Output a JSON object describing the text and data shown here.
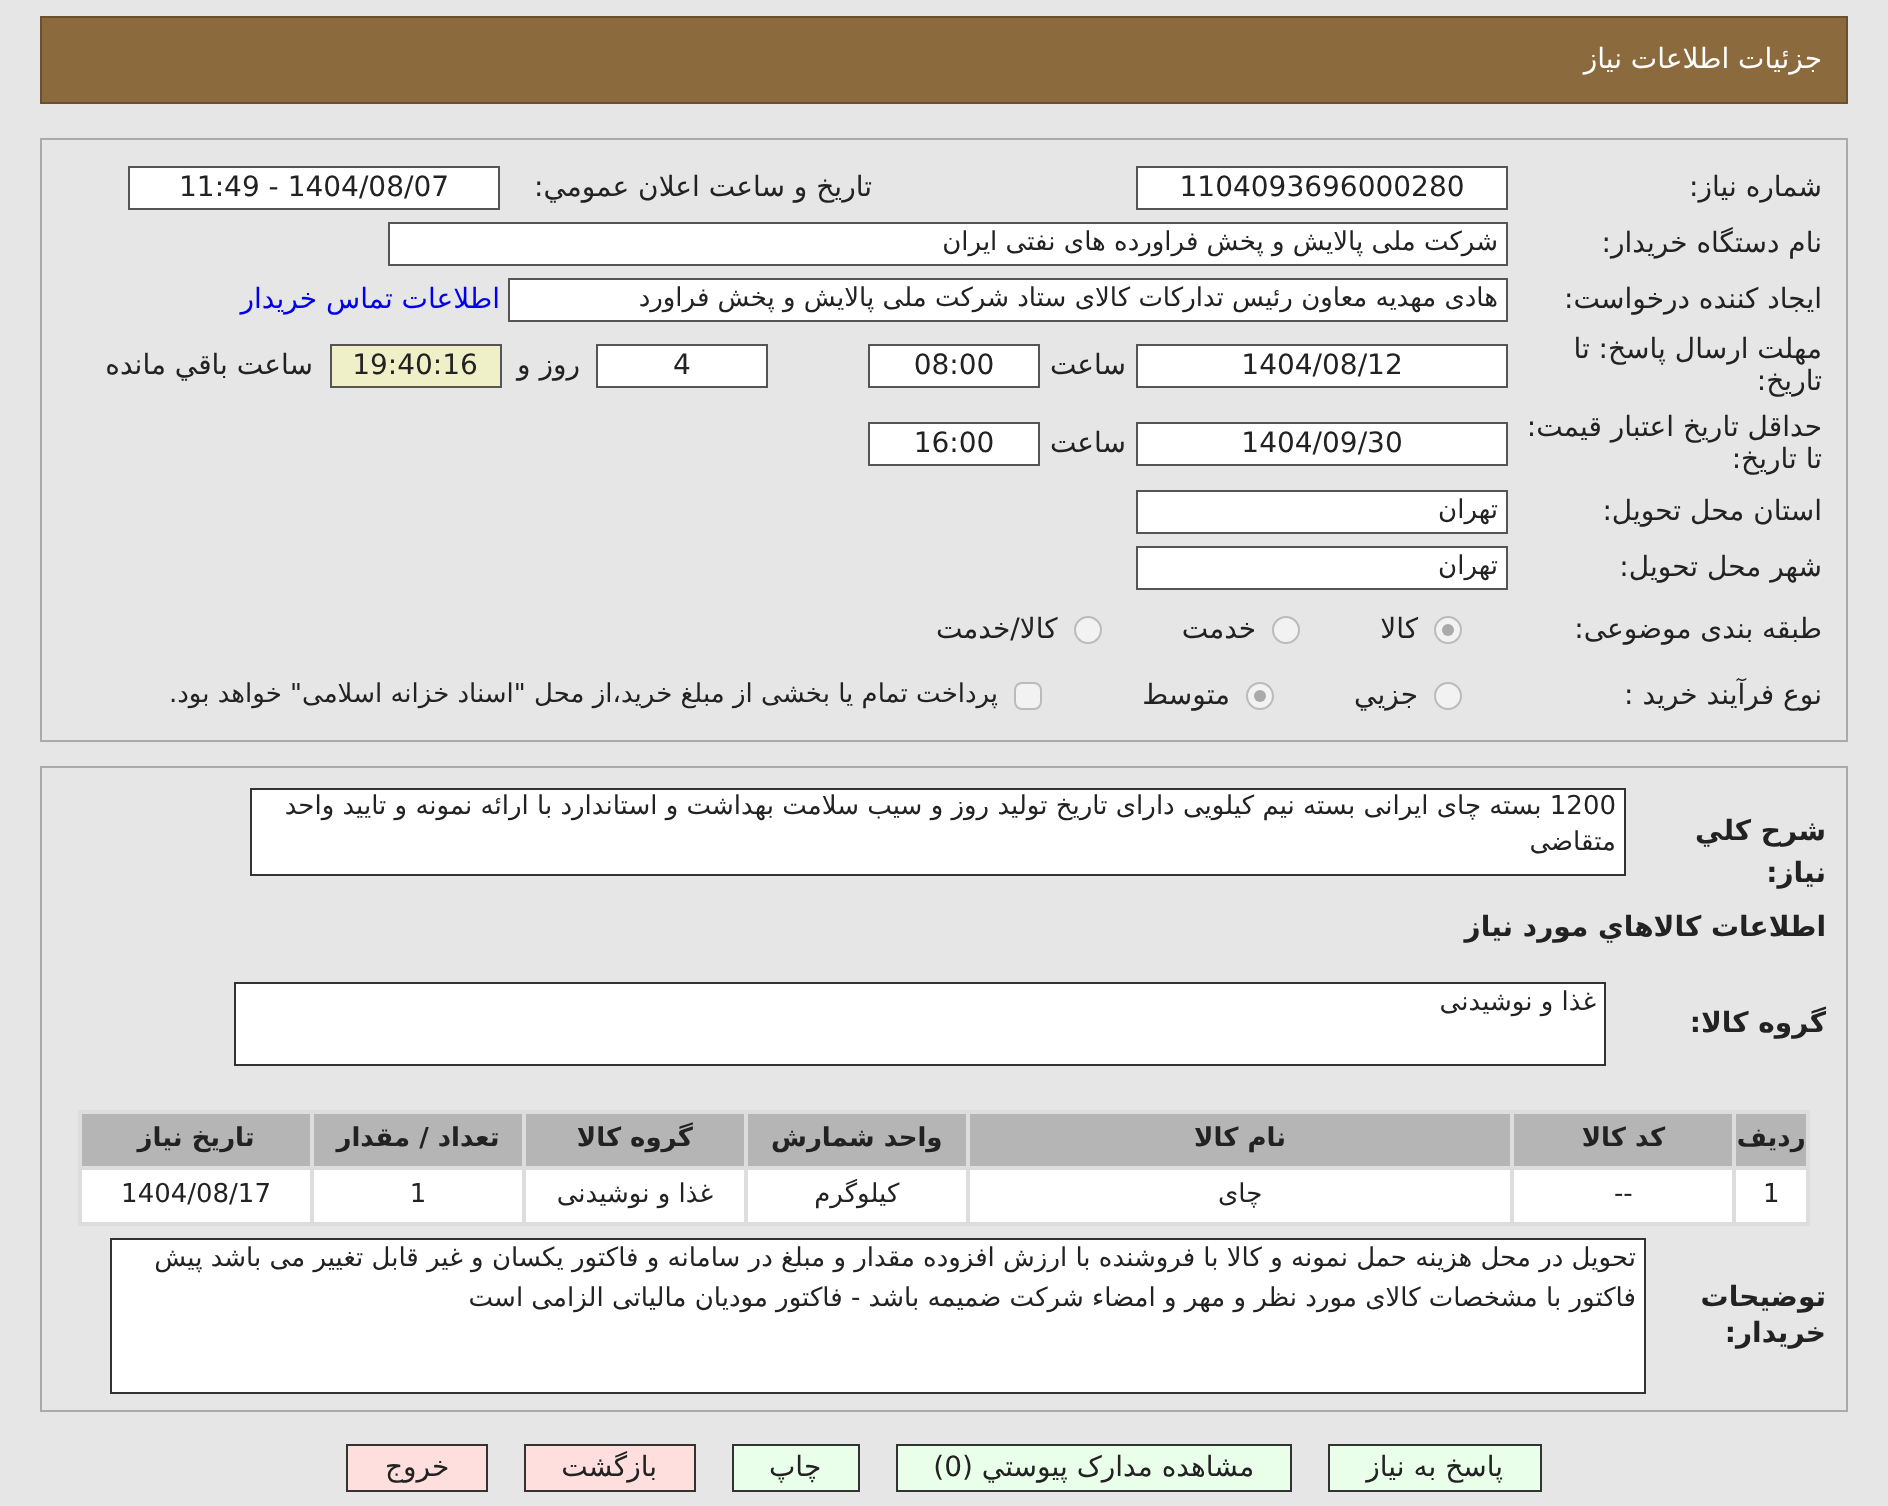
{
  "header": {
    "title": "جزئیات اطلاعات نیاز"
  },
  "need_number": {
    "label": "شماره نیاز:",
    "value": "1104093696000280"
  },
  "announce": {
    "label": "تاريخ و ساعت اعلان عمومي:",
    "value": "1404/08/07 - 11:49"
  },
  "buyer_org": {
    "label": "نام دستگاه خریدار:",
    "value": "شرکت ملی پالایش و پخش فراورده های نفتی ایران"
  },
  "requester": {
    "label": "ایجاد کننده درخواست:",
    "value": "هادی مهدیه معاون رئیس تدارکات کالای ستاد شرکت ملی پالایش و پخش فراورد",
    "link": "اطلاعات تماس خریدار"
  },
  "deadline": {
    "label": "مهلت ارسال پاسخ: تا تاریخ:",
    "date": "1404/08/12",
    "time_label": "ساعت",
    "time": "08:00",
    "days": "4",
    "days_label": "روز و",
    "remaining": "19:40:16",
    "remaining_label": "ساعت باقي مانده"
  },
  "validity": {
    "label": "حداقل تاریخ اعتبار قیمت: تا تاریخ:",
    "date": "1404/09/30",
    "time_label": "ساعت",
    "time": "16:00"
  },
  "province": {
    "label": "استان محل تحویل:",
    "value": "تهران"
  },
  "city": {
    "label": "شهر محل تحویل:",
    "value": "تهران"
  },
  "category": {
    "label": "طبقه بندی موضوعی:",
    "options": [
      {
        "label": "کالا",
        "selected": true
      },
      {
        "label": "خدمت",
        "selected": false
      },
      {
        "label": "کالا/خدمت",
        "selected": false
      }
    ]
  },
  "purchase_type": {
    "label": "نوع فرآیند خرید :",
    "options": [
      {
        "label": "جزيي",
        "selected": false
      },
      {
        "label": "متوسط",
        "selected": true
      }
    ],
    "treasury": {
      "label": "پرداخت تمام یا بخشی از مبلغ خرید،از محل \"اسناد خزانه اسلامی\" خواهد بود.",
      "checked": false
    }
  },
  "description": {
    "label": "شرح كلي نياز:",
    "value": "1200 بسته چای ایرانی بسته نیم کیلویی دارای تاریخ تولید روز و سیب سلامت بهداشت و استاندارد  با ارائه نمونه و تایید واحد متقاضی"
  },
  "goods_title": "اطلاعات كالاهاي مورد نياز",
  "goods_group": {
    "label": "گروه کالا:",
    "value": "غذا و نوشیدنی"
  },
  "table": {
    "columns": [
      "ردیف",
      "کد کالا",
      "نام کالا",
      "واحد شمارش",
      "گروه کالا",
      "تعداد / مقدار",
      "تاریخ نیاز"
    ],
    "rows": [
      [
        "1",
        "--",
        "چای",
        "کیلوگرم",
        "غذا و نوشیدنی",
        "1",
        "1404/08/17"
      ]
    ]
  },
  "buyer_notes": {
    "label": "توضیحات خریدار:",
    "value": "تحویل در محل هزینه حمل نمونه و کالا با فروشنده با ارزش افزوده مقدار و مبلغ در سامانه و فاکتور یکسان و غیر قابل تغییر می باشد پیش فاکتور با مشخصات کالای مورد نظر و مهر و امضاء شرکت ضمیمه باشد - فاکتور مودیان مالیاتی الزامی است"
  },
  "buttons": [
    {
      "label": "پاسخ به نیاز",
      "color": "#eaffea"
    },
    {
      "label": "مشاهده مدارک پیوستي (0)",
      "color": "#eaffea"
    },
    {
      "label": "چاپ",
      "color": "#eaffea"
    },
    {
      "label": "بازگشت",
      "color": "#ffdede"
    },
    {
      "label": "خروج",
      "color": "#ffdede"
    }
  ]
}
